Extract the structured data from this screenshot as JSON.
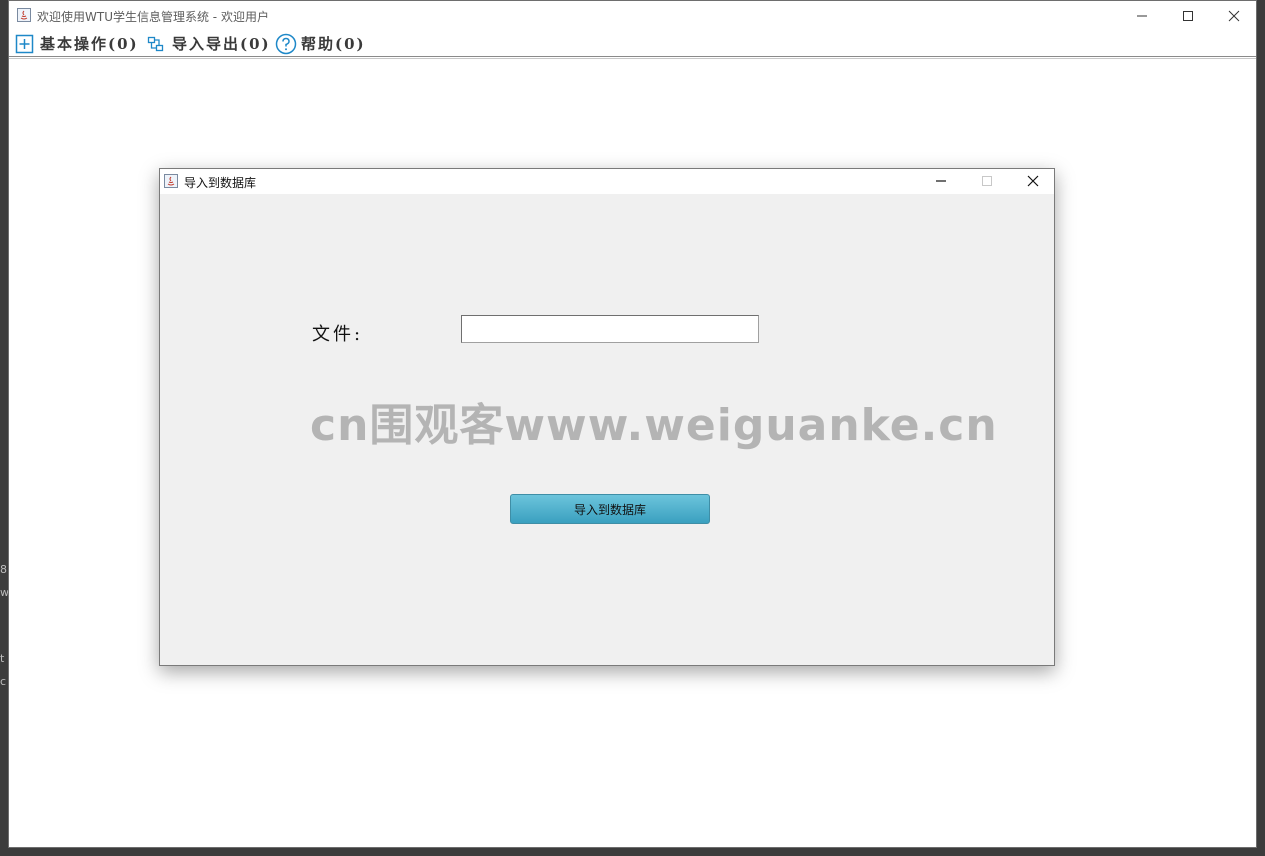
{
  "main_window": {
    "title": "欢迎使用WTU学生信息管理系统 - 欢迎用户",
    "controls": {
      "minimize_icon": "minimize-icon",
      "maximize_icon": "maximize-icon",
      "close_icon": "close-icon"
    }
  },
  "menu": {
    "items": [
      {
        "label": "基本操作(0)",
        "icon": "plus-square-icon"
      },
      {
        "label": "导入导出(0)",
        "icon": "hierarchy-icon"
      },
      {
        "label": "帮助(0)",
        "icon": "help-circle-icon"
      }
    ],
    "icon_color": "#1e88c8"
  },
  "dialog": {
    "title": "导入到数据库",
    "file_label": "文件:",
    "file_input_value": "",
    "button_label": "导入到数据库",
    "button_color": "#4fb3d1"
  },
  "watermark": "cn围观客www.weiguanke.cn",
  "desktop_fragments": [
    "8",
    "w",
    "t",
    "c"
  ]
}
